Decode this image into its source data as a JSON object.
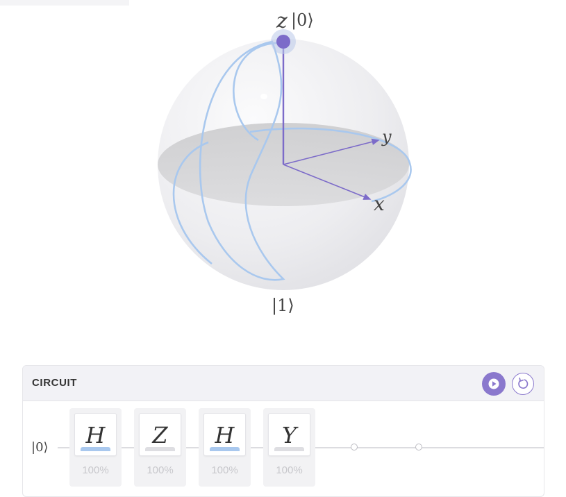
{
  "bloch_sphere": {
    "z_axis_label": "z",
    "top_state_label": "|0⟩",
    "bottom_state_label": "|1⟩",
    "x_axis_label": "x",
    "y_axis_label": "y"
  },
  "circuit": {
    "title": "CIRCUIT",
    "play_icon": "play-icon",
    "reset_icon": "reset-icon",
    "qubit_label": "|0⟩",
    "gates": [
      {
        "symbol": "H",
        "percent": "100%",
        "bar_color": "#a9c8ee"
      },
      {
        "symbol": "Z",
        "percent": "100%",
        "bar_color": "#dedee2"
      },
      {
        "symbol": "H",
        "percent": "100%",
        "bar_color": "#a9c8ee"
      },
      {
        "symbol": "Y",
        "percent": "100%",
        "bar_color": "#dedee2"
      }
    ],
    "empty_slots": 2
  },
  "colors": {
    "accent": "#8a78cd",
    "state_vector": "#7c6bc9",
    "trajectory": "#a9c8ee",
    "equator_fill": "#d2d2d4",
    "sphere_fill": "#eeeef1"
  }
}
